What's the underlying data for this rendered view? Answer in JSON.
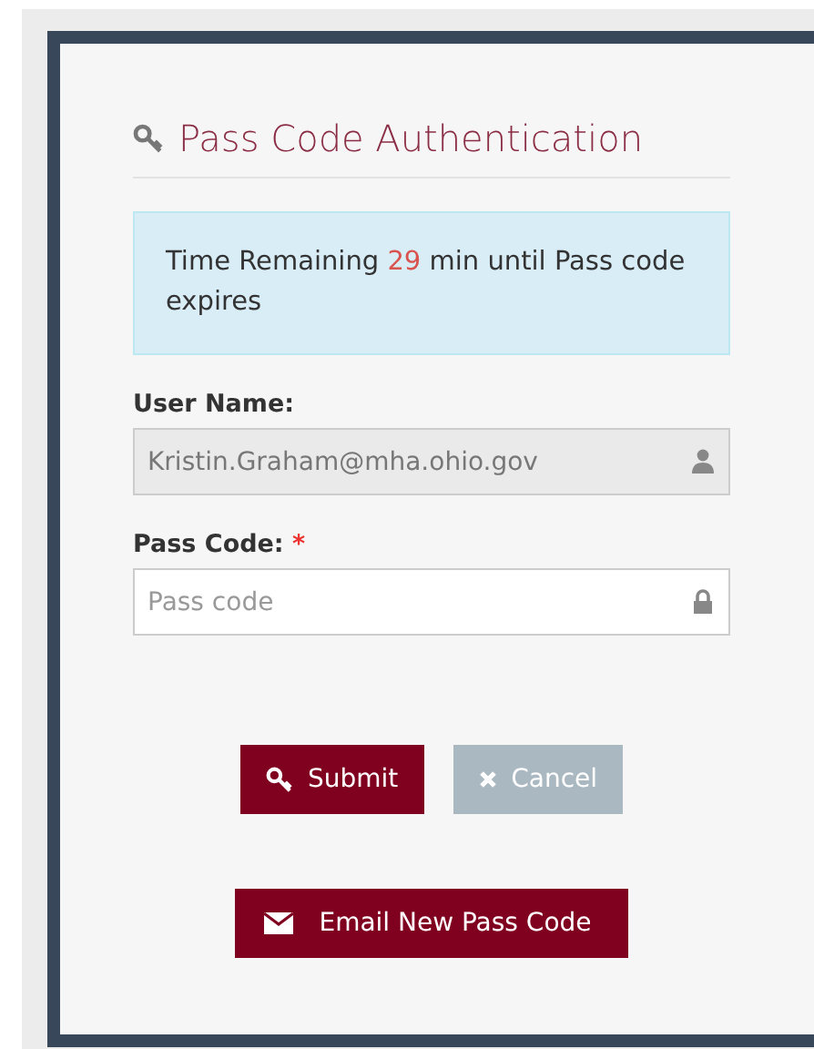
{
  "title": "Pass Code Authentication",
  "notice": {
    "before": "Time Remaining",
    "minutes": "29",
    "after": "min until Pass code expires"
  },
  "fields": [
    {
      "label": "User Name:",
      "value": "Kristin.Graham@mha.ohio.gov",
      "disabled": true
    },
    {
      "label": "Pass Code:",
      "required": true,
      "required_mark": "*",
      "placeholder": "Pass code",
      "disabled": false
    }
  ],
  "buttons": [
    {
      "label": "Submit",
      "kind": "primary"
    },
    {
      "label": "Cancel",
      "kind": "secondary"
    }
  ],
  "email_button": {
    "label": "Email New Pass Code"
  }
}
